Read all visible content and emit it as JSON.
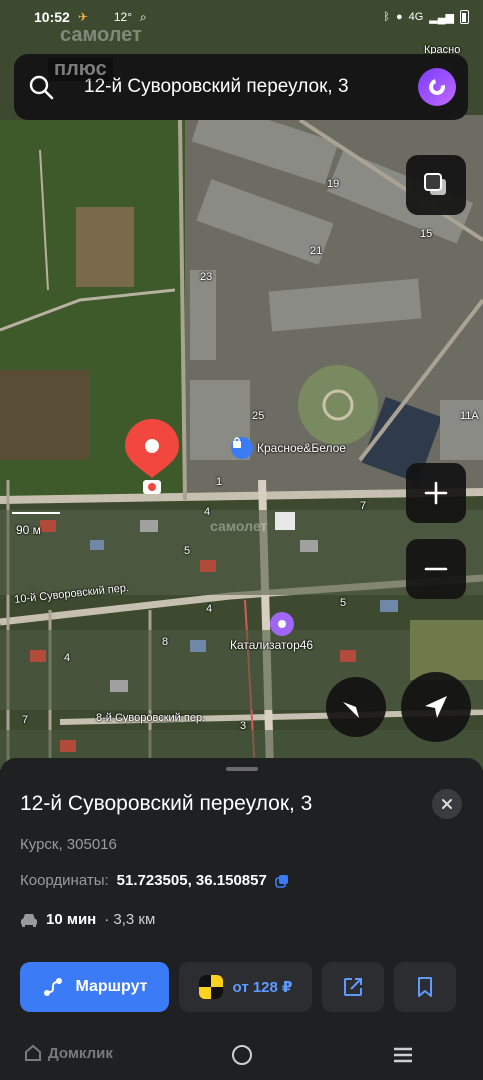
{
  "status_bar": {
    "time": "10:52",
    "temperature": "12°",
    "network": "4G"
  },
  "search": {
    "query": "12-й Суворовский переулок, 3",
    "watermark_top": "самолет",
    "watermark_bottom": "плюс"
  },
  "map": {
    "scale_label": "90 м",
    "poi_shop": "Красное&Белое",
    "poi_service": "Катализатор46",
    "street_10": "10-й Суворовский пер.",
    "street_8": "8-й Суворовский пер.",
    "road_label": "Красно",
    "house_numbers": [
      "19",
      "15",
      "21",
      "23",
      "25",
      "11А",
      "4",
      "7",
      "5",
      "4",
      "5",
      "8",
      "4",
      "7",
      "3",
      "1"
    ],
    "watermark": "самолет"
  },
  "sheet": {
    "title": "12-й Суворовский переулок, 3",
    "subtitle": "Курск, 305016",
    "coords_label": "Координаты:",
    "coords_value": "51.723505, 36.150857",
    "route_time": "10 мин",
    "route_distance": "· 3,3 км",
    "route_button": "Маршрут",
    "taxi_button": "от 128 ₽"
  },
  "navbar": {
    "brand": "Домклик"
  },
  "colors": {
    "accent": "#3b7bf6",
    "pin": "#f2473f",
    "taxi": "#ffd21e",
    "sheet_bg": "#1f2022"
  }
}
